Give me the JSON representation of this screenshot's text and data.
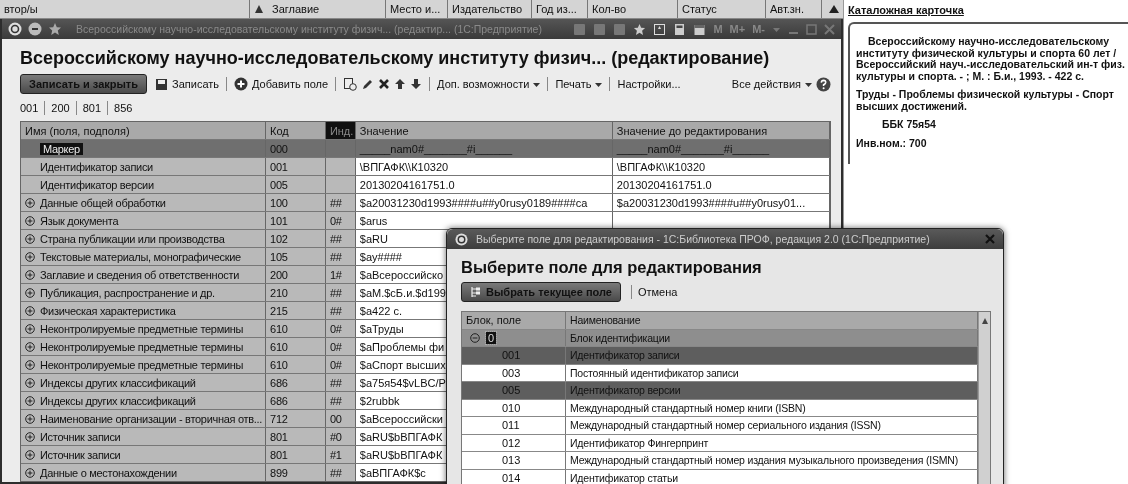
{
  "background_list": {
    "columns": [
      "втор/ы",
      "Заглавие",
      "Место и...",
      "Издательство",
      "Год из...",
      "Кол-во",
      "Статус",
      "Авт.зн."
    ]
  },
  "window": {
    "title": "Всероссийскому научно-исследовательскому институту физич... (редактир... (1С:Предприятие)",
    "memory_buttons": [
      "M",
      "M+",
      "M-"
    ]
  },
  "form": {
    "title": "Всероссийскому научно-исследовательскому институту физич... (редактирование)",
    "toolbar": {
      "save_close": "Записать и закрыть",
      "save": "Записать",
      "add_field": "Добавить поле",
      "more": "Доп. возможности",
      "print": "Печать",
      "settings": "Настройки...",
      "all_actions": "Все действия"
    },
    "field_tabs": [
      "001",
      "200",
      "801",
      "856"
    ],
    "table": {
      "columns": [
        "Имя (поля, подполя)",
        "Код",
        "Инд.",
        "Значение",
        "Значение до редактирования"
      ],
      "rows": [
        {
          "kind": "marker",
          "selected": true,
          "name": "Маркер",
          "code": "000",
          "ind": "",
          "value": "_____nam0#_______#i______",
          "old_value": "_____nam0#_______#i______"
        },
        {
          "kind": "field",
          "selected": false,
          "name": "Идентификатор записи",
          "code": "001",
          "ind": "",
          "value": "\\ВПГАФК\\\\К10320",
          "old_value": "\\ВПГАФК\\\\К10320"
        },
        {
          "kind": "field",
          "selected": false,
          "name": "Идентификатор версии",
          "code": "005",
          "ind": "",
          "value": "20130204161751.0",
          "old_value": "20130204161751.0"
        },
        {
          "kind": "group",
          "selected": false,
          "name": "Данные общей обработки",
          "code": "100",
          "ind": "##",
          "value": "$a20031230d1993####u##y0rusy0189####ca",
          "old_value": "$a20031230d1993####u##y0rusy01..."
        },
        {
          "kind": "group",
          "selected": false,
          "name": "Язык документа",
          "code": "101",
          "ind": "0#",
          "value": "$arus"
        },
        {
          "kind": "group",
          "selected": false,
          "name": "Страна публикации или производства",
          "code": "102",
          "ind": "##",
          "value": "$aRU"
        },
        {
          "kind": "group",
          "selected": false,
          "name": "Текстовые материалы, монографические",
          "code": "105",
          "ind": "##",
          "value": "$ay####"
        },
        {
          "kind": "group",
          "selected": false,
          "name": "Заглавие и сведения об ответственности",
          "code": "200",
          "ind": "1#",
          "value": "$aВсероссийско"
        },
        {
          "kind": "group",
          "selected": false,
          "name": "Публикация, распространение и др.",
          "code": "210",
          "ind": "##",
          "value": "$aМ.$cБ.и.$d199"
        },
        {
          "kind": "group",
          "selected": false,
          "name": "Физическая характеристика",
          "code": "215",
          "ind": "##",
          "value": "$a422 с."
        },
        {
          "kind": "group",
          "selected": false,
          "name": "Неконтролируемые предметные термины",
          "code": "610",
          "ind": "0#",
          "value": "$aТруды"
        },
        {
          "kind": "group",
          "selected": false,
          "name": "Неконтролируемые предметные термины",
          "code": "610",
          "ind": "0#",
          "value": "$aПроблемы фи"
        },
        {
          "kind": "group",
          "selected": false,
          "name": "Неконтролируемые предметные термины",
          "code": "610",
          "ind": "0#",
          "value": "$aСпорт высших"
        },
        {
          "kind": "group",
          "selected": false,
          "name": "Индексы других классификаций",
          "code": "686",
          "ind": "##",
          "value": "$a75я54$vLBC/P"
        },
        {
          "kind": "group",
          "selected": false,
          "name": "Индексы других классификаций",
          "code": "686",
          "ind": "##",
          "value": "$2rubbk"
        },
        {
          "kind": "group",
          "selected": false,
          "name": "Наименование организации - вторичная отв...",
          "code": "712",
          "ind": "00",
          "value": "$aВсероссийски"
        },
        {
          "kind": "group",
          "selected": false,
          "name": "Источник записи",
          "code": "801",
          "ind": "#0",
          "value": "$aRU$bВПГАФК"
        },
        {
          "kind": "group",
          "selected": false,
          "name": "Источник записи",
          "code": "801",
          "ind": "#1",
          "value": "$aRU$bВПГАФК"
        },
        {
          "kind": "group",
          "selected": false,
          "name": "Данные о местонахождении",
          "code": "899",
          "ind": "##",
          "value": "$aВПГАФК$c"
        }
      ]
    }
  },
  "card": {
    "title": "Каталожная карточка",
    "paragraphs": [
      {
        "kind": "indent",
        "text": "Всероссийскому научно-исследовательскому институту физической культуры и спорта 60 лет / Всероссийский науч.-исследовательский ин-т физ. культуры и спорта. - ; М. : Б.и., 1993. - 422 с."
      },
      {
        "kind": "plain",
        "text": "Труды - Проблемы физической культуры - Спорт высших достижений."
      },
      {
        "kind": "indent",
        "text": "ББК 75я54"
      },
      {
        "kind": "plain",
        "text": "Инв.ном.: 700"
      }
    ]
  },
  "dialog": {
    "title": "Выберите поле для редактирования - 1С:Библиотека ПРОФ, редакция 2.0  (1С:Предприятие)",
    "heading": "Выберите поле для редактирования",
    "select_button": "Выбрать текущее поле",
    "cancel": "Отмена",
    "columns": [
      "Блок, поле",
      "Наименование"
    ],
    "rows": [
      {
        "kind": "group",
        "expanded": true,
        "selected": false,
        "code": "0",
        "name": "Блок идентификации"
      },
      {
        "kind": "field",
        "selected": true,
        "code": "001",
        "name": "Идентификатор записи"
      },
      {
        "kind": "field",
        "selected": false,
        "code": "003",
        "name": "Постоянный идентификатор записи"
      },
      {
        "kind": "field",
        "selected": true,
        "code": "005",
        "name": "Идентификатор версии"
      },
      {
        "kind": "field",
        "selected": false,
        "code": "010",
        "name": "Международный стандартный номер книги (ISBN)"
      },
      {
        "kind": "field",
        "selected": false,
        "code": "011",
        "name": "Международный стандартный номер сериального издания (ISSN)"
      },
      {
        "kind": "field",
        "selected": false,
        "code": "012",
        "name": "Идентификатор Фингерпринт"
      },
      {
        "kind": "field",
        "selected": false,
        "code": "013",
        "name": "Международный стандартный номер издания музыкального произведения (ISMN)"
      },
      {
        "kind": "field",
        "selected": false,
        "code": "014",
        "name": "Идентификатор статьи"
      }
    ]
  }
}
